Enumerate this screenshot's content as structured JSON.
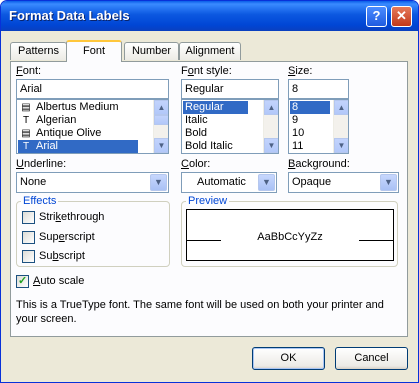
{
  "window": {
    "title": "Format Data Labels",
    "help_glyph": "?",
    "close_glyph": "✕"
  },
  "tabs": [
    {
      "label": "Patterns"
    },
    {
      "label": "Font"
    },
    {
      "label": "Number"
    },
    {
      "label": "Alignment"
    }
  ],
  "font": {
    "label_hot": "F",
    "label_rest": "ont:",
    "value": "Arial",
    "list": [
      "Albertus Medium",
      "Algerian",
      "Antique Olive",
      "Arial"
    ],
    "selected": "Arial"
  },
  "font_style": {
    "label_pre": "F",
    "label_hot": "o",
    "label_rest": "nt style:",
    "value": "Regular",
    "list": [
      "Regular",
      "Italic",
      "Bold",
      "Bold Italic"
    ],
    "selected": "Regular"
  },
  "size": {
    "label_hot": "S",
    "label_rest": "ize:",
    "value": "8",
    "list": [
      "8",
      "9",
      "10",
      "11"
    ],
    "selected": "8"
  },
  "underline": {
    "label_hot": "U",
    "label_rest": "nderline:",
    "value": "None"
  },
  "color": {
    "label_hot": "C",
    "label_rest": "olor:",
    "value": "Automatic"
  },
  "background": {
    "label_hot": "B",
    "label_rest": "ackground:",
    "value": "Opaque"
  },
  "effects": {
    "title": "Effects",
    "strikethrough": {
      "hot": "k",
      "pre": "Stri",
      "rest": "ethrough"
    },
    "superscript": {
      "hot": "e",
      "pre": "Sup",
      "rest": "rscript"
    },
    "subscript": {
      "hot": "b",
      "pre": "Su",
      "rest": "script"
    }
  },
  "preview": {
    "title": "Preview",
    "sample": "AaBbCcYyZz"
  },
  "auto_scale": {
    "hot": "A",
    "rest": "uto scale",
    "checked": true
  },
  "info_text": "This is a TrueType font.  The same font will be used on both your printer and your screen.",
  "buttons": {
    "ok": "OK",
    "cancel": "Cancel"
  },
  "icons": {
    "truetype_icon": "T",
    "printer_font_icon": "▤",
    "arrow_up": "▲",
    "arrow_down": "▼"
  }
}
